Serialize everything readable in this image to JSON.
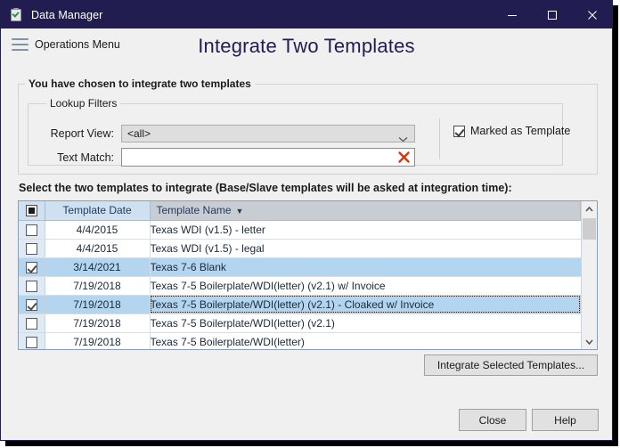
{
  "window": {
    "title": "Data Manager",
    "icon": "clipboard-check-icon",
    "controls": {
      "minimize": "minimize-icon",
      "maximize": "maximize-icon",
      "close": "close-icon"
    }
  },
  "header": {
    "menu_label": "Operations Menu",
    "page_title": "Integrate Two Templates"
  },
  "outer_group": {
    "label": "You have chosen to integrate two templates"
  },
  "lookup_filters": {
    "label": "Lookup Filters",
    "report_view": {
      "label": "Report View:",
      "value": "<all>"
    },
    "text_match": {
      "label": "Text Match:",
      "value": "",
      "placeholder": "",
      "clear_icon": "red-x-clear-icon"
    },
    "marked_as_template": {
      "label": "Marked as Template",
      "checked": true
    }
  },
  "instruction": "Select the two templates to integrate (Base/Slave templates will be asked at integration time):",
  "grid": {
    "columns": [
      "",
      "Template Date",
      "Template Name"
    ],
    "sort_column": "Template Name",
    "sort_direction": "descending",
    "sort_indicator": "▼",
    "header_select_all": "partially-selected",
    "rows": [
      {
        "checked": false,
        "selected": false,
        "focused": false,
        "date": "4/4/2015",
        "name": "Texas WDI (v1.5) - letter"
      },
      {
        "checked": false,
        "selected": false,
        "focused": false,
        "date": "4/4/2015",
        "name": "Texas WDI (v1.5) - legal"
      },
      {
        "checked": true,
        "selected": true,
        "focused": false,
        "date": "3/14/2021",
        "name": "Texas 7-6 Blank"
      },
      {
        "checked": false,
        "selected": false,
        "focused": false,
        "date": "7/19/2018",
        "name": "Texas 7-5 Boilerplate/WDI(letter) (v2.1) w/ Invoice"
      },
      {
        "checked": true,
        "selected": true,
        "focused": true,
        "date": "7/19/2018",
        "name": "Texas 7-5 Boilerplate/WDI(letter) (v2.1) - Cloaked w/ Invoice"
      },
      {
        "checked": false,
        "selected": false,
        "focused": false,
        "date": "7/19/2018",
        "name": "Texas 7-5 Boilerplate/WDI(letter) (v2.1)"
      },
      {
        "checked": false,
        "selected": false,
        "focused": false,
        "date": "7/19/2018",
        "name": "Texas 7-5 Boilerplate/WDI(letter)"
      }
    ],
    "scrollbar": {
      "up_icon": "chevron-up-icon",
      "down_icon": "chevron-down-icon"
    }
  },
  "buttons": {
    "integrate": "Integrate Selected Templates...",
    "close": "Close",
    "help": "Help"
  },
  "colors": {
    "titlebar": "#211d50",
    "accent_title": "#211d50",
    "selection": "#b3d5f0",
    "grid_header": "#cfe0f0",
    "clear_x": "#cc3a17",
    "hamburger": "#7f93ab"
  }
}
